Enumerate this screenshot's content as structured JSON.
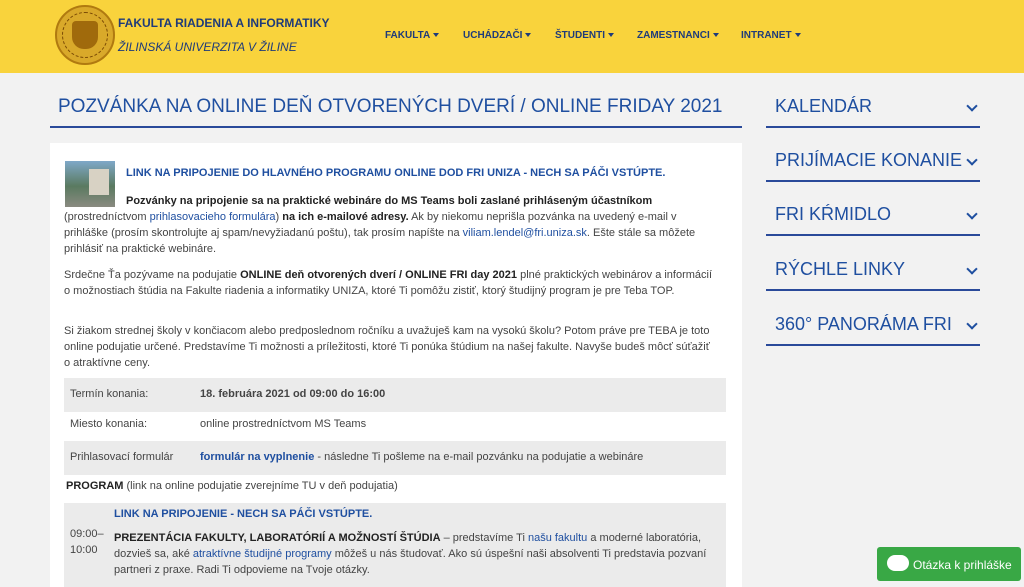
{
  "header": {
    "faculty": "FAKULTA RIADENIA A INFORMATIKY",
    "university": "ŽILINSKÁ UNIVERZITA V ŽILINE",
    "nav": [
      "FAKULTA",
      "UCHÁDZAČI",
      "ŠTUDENTI",
      "ZAMESTNANCI",
      "INTRANET"
    ]
  },
  "page": {
    "title": "POZVÁNKA NA ONLINE DEŇ OTVORENÝCH DVERÍ / ONLINE FRIDAY 2021",
    "link_title": "LINK NA PRIPOJENIE DO HLAVNÉHO PROGRAMU ONLINE DOD FRI UNIZA - NECH SA PÁČI VSTÚPTE.",
    "p1_bold": "Pozvánky na pripojenie sa na praktické webináre do MS Teams boli zaslané prihláseným účastníkom",
    "p1_pre": "(prostredníctvom ",
    "p1_link": "prihlasovacieho formulára",
    "p1_post": ") ",
    "p1_bold2": "na ich e-mailové adresy.",
    "p1_rest": " Ak by niekomu neprišla pozvánka na uvedený e-mail v prihláške (prosím skontrolujte aj spam/nevyžiadanú poštu), tak prosím napíšte na ",
    "p1_email": "viliam.lendel@fri.uniza.sk",
    "p1_end": ". Ešte stále sa môžete prihlásiť na praktické webináre.",
    "p2_a": "Srdečne Ťa pozývame na podujatie ",
    "p2_bold": "ONLINE deň otvorených dverí / ONLINE FRI day 2021",
    "p2_b": " plné praktických webinárov a informácií o možnostiach štúdia na Fakulte riadenia a informatiky UNIZA, ktoré Ti pomôžu zistiť, ktorý študijný program je pre Teba TOP.",
    "p3": "Si žiakom strednej školy v končiacom alebo predposlednom ročníku a uvažuješ kam na vysokú školu? Potom práve pre TEBA je toto online podujatie určené. Predstavíme Ti možnosti a príležitosti, ktoré Ti ponúka štúdium na našej fakulte. Navyše budeš môcť súťažiť o atraktívne ceny.",
    "rows": [
      {
        "key": "Termín konania:",
        "value": "18. februára 2021 od 09:00 do 16:00"
      },
      {
        "key": "Miesto konania:",
        "value": "online prostredníctvom MS Teams"
      },
      {
        "key": "Prihlasovací formulár",
        "value_link": "formulár na vyplnenie",
        "value_rest": " - následne Ti pošleme na e-mail pozvánku na podujatie a webináre"
      }
    ],
    "program_bold": "PROGRAM",
    "program_rest": " (link na online podujatie zverejníme TU v deň podujatia)",
    "prog_link": "LINK NA PRIPOJENIE - NECH SA PÁČI VSTÚPTE.",
    "prog_time": "09:00–\n10:00",
    "prog_time_a": "09:00–",
    "prog_time_b": "10:00",
    "prog_bold": "PREZENTÁCIA FAKULTY, LABORATÓRIÍ A MOŽNOSTÍ ŠTÚDIA",
    "prog_a": " – predstavíme Ti ",
    "prog_link1": "našu fakultu",
    "prog_b": " a moderné laboratória, dozvieš sa, aké ",
    "prog_link2": "atraktívne študijné programy",
    "prog_c": " môžeš u nás študovať. Ako sú úspešní naši absolventi Ti predstavia pozvaní partneri z praxe. Radi Ti odpovieme na Tvoje otázky."
  },
  "sidebar": [
    "KALENDÁR",
    "PRIJÍMACIE KONANIE",
    "FRI KŔMIDLO",
    "RÝCHLE LINKY",
    "360° PANORÁMA FRI"
  ],
  "chat_button": "Otázka k prihláške"
}
